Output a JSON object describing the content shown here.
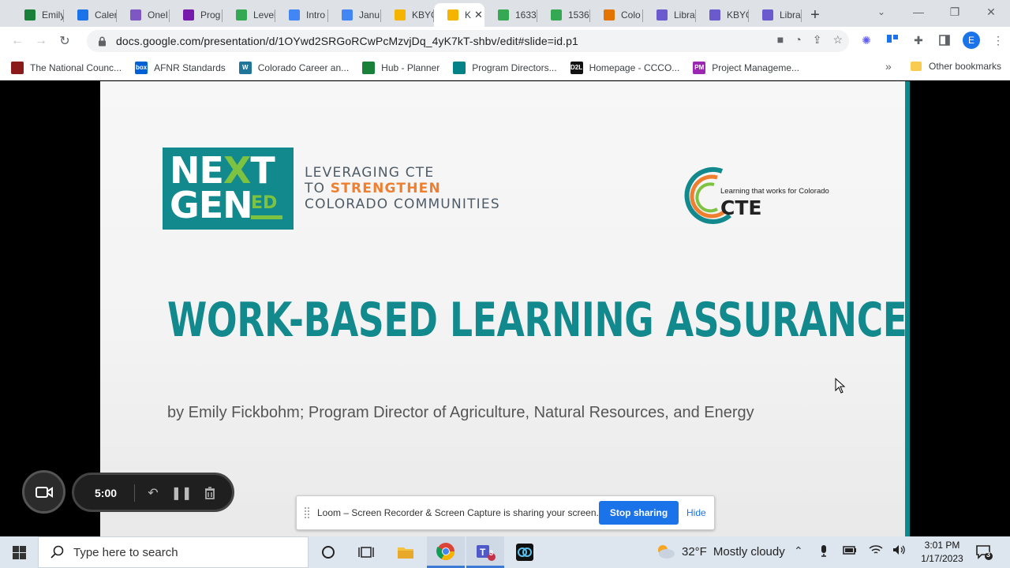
{
  "tabs": [
    {
      "title": "Emily",
      "color": "#188038",
      "icon": "planner-icon"
    },
    {
      "title": "Caler",
      "color": "#1a73e8",
      "icon": "calendar-icon"
    },
    {
      "title": "OneI",
      "color": "#7e57c2",
      "icon": "onedrive-icon"
    },
    {
      "title": "Prog",
      "color": "#7719aa",
      "icon": "onenote-icon"
    },
    {
      "title": "Level",
      "color": "#34a853",
      "icon": "drive-icon"
    },
    {
      "title": "Intro",
      "color": "#4285f4",
      "icon": "docs-icon"
    },
    {
      "title": "Janu",
      "color": "#4285f4",
      "icon": "docs-icon"
    },
    {
      "title": "KBYG",
      "color": "#f4b400",
      "icon": "slides-icon"
    },
    {
      "title": "K",
      "color": "#f4b400",
      "icon": "slides-icon",
      "active": true
    },
    {
      "title": "1633",
      "color": "#34a853",
      "icon": "drive-icon"
    },
    {
      "title": "1536",
      "color": "#34a853",
      "icon": "drive-icon"
    },
    {
      "title": "Colo",
      "color": "#e37400",
      "icon": "cte-icon"
    },
    {
      "title": "Libra",
      "color": "#6a5acd",
      "icon": "library-icon"
    },
    {
      "title": "KBYG",
      "color": "#6a5acd",
      "icon": "library-icon"
    },
    {
      "title": "Libra",
      "color": "#6a5acd",
      "icon": "library-icon"
    }
  ],
  "url": "docs.google.com/presentation/d/1OYwd2SRGoRCwPcMzvjDq_4yK7kT-shbv/edit#slide=id.p1",
  "profile_initial": "E",
  "bookmarks": [
    {
      "label": "The National Counc...",
      "color": "#8b1a1a"
    },
    {
      "label": "AFNR Standards",
      "color": "#0061d5",
      "badge": "box"
    },
    {
      "label": "Colorado Career an...",
      "color": "#21759b",
      "badge": "W"
    },
    {
      "label": "Hub - Planner",
      "color": "#188038"
    },
    {
      "label": "Program Directors...",
      "color": "#038387"
    },
    {
      "label": "Homepage - CCCO...",
      "color": "#111111",
      "badge": "D2L"
    },
    {
      "label": "Project Manageme...",
      "color": "#9c27b0",
      "badge": "PM"
    }
  ],
  "bookmarks_more": "»",
  "other_bookmarks": "Other bookmarks",
  "slide": {
    "nextgen_line1_a": "NE",
    "nextgen_line1_b": "X",
    "nextgen_line1_c": "T",
    "nextgen_line2": "GEN",
    "nextgen_ed": "ED",
    "tagline_1": "LEVERAGING CTE",
    "tagline_2a": "TO ",
    "tagline_2b": "STRENGTHEN",
    "tagline_3": "COLORADO COMMUNITIES",
    "cte_tagline": "Learning that works for Colorado",
    "cte_word": "CTE",
    "title": "WORK-BASED LEARNING ASSURANCE",
    "byline": "by Emily Fickbohm; Program Director of Agriculture, Natural Resources, and Energy",
    "teal": "#11898d",
    "green": "#7ec242",
    "orange": "#ef7f2f"
  },
  "loom": {
    "timer": "5:00",
    "share_message": "Loom – Screen Recorder & Screen Capture is sharing your screen.",
    "stop_label": "Stop sharing",
    "hide_label": "Hide"
  },
  "taskbar": {
    "search_placeholder": "Type here to search",
    "weather_temp": "32°F",
    "weather_desc": "Mostly cloudy",
    "time": "3:01 PM",
    "date": "1/17/2023",
    "teams_badge": "3",
    "notif_count": "3"
  }
}
